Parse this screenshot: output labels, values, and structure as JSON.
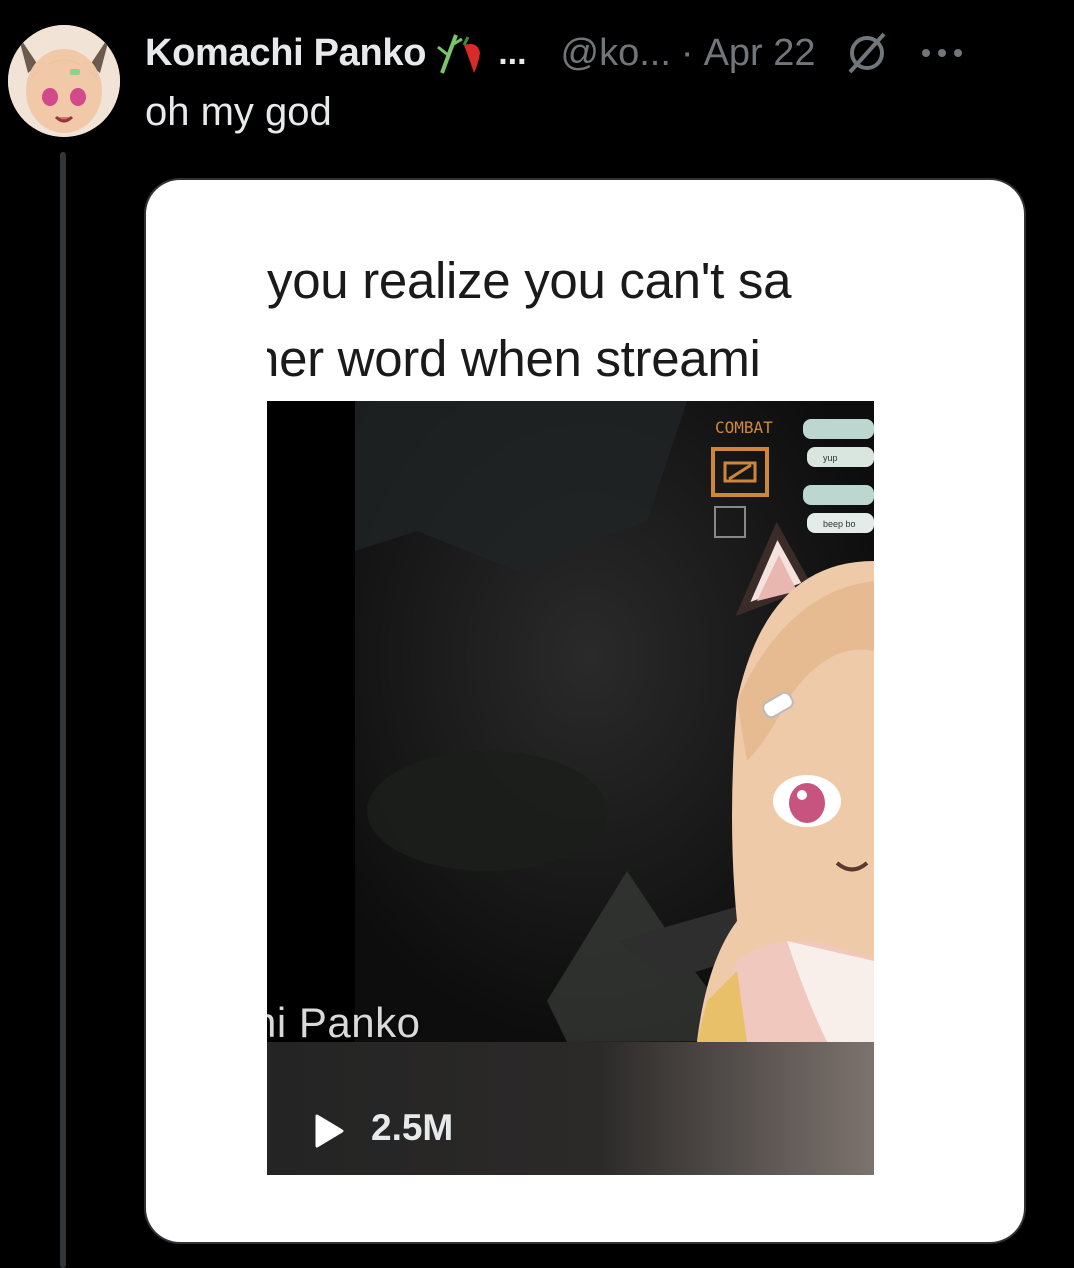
{
  "tweet": {
    "author_name": "Komachi Panko",
    "name_truncation": "...",
    "handle": "@ko...",
    "separator": "·",
    "date": "Apr 22",
    "text": "oh my god",
    "icons": {
      "avatar": "avatar",
      "name_emoji": "bamboo-chili-emoji-icon",
      "grok": "grok-icon",
      "more": "more-options-icon"
    }
  },
  "media": {
    "caption_line1": "you realize you can't sa",
    "caption_line2": "her word when streami",
    "overlay_label": "COMBAT",
    "chat_messages": [
      "yup",
      "beep bo"
    ],
    "watermark": "hi Panko",
    "view_count": "2.5M",
    "play_icon": "play-icon"
  },
  "colors": {
    "background": "#000000",
    "primary_text": "#e7e9ea",
    "secondary_text": "#71767b",
    "card_background": "#ffffff",
    "thread_line": "#333639"
  }
}
